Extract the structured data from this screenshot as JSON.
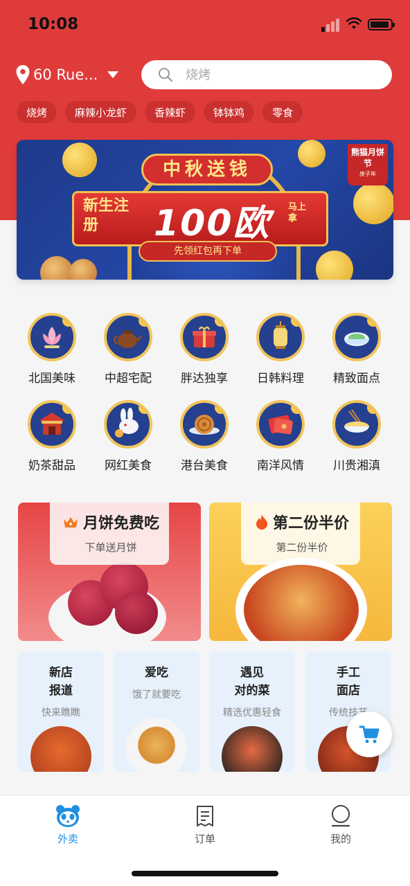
{
  "status_bar": {
    "time": "10:08"
  },
  "header": {
    "location": "60 Rue...",
    "search_placeholder": "烧烤"
  },
  "quick_tags": [
    "烧烤",
    "麻辣小龙虾",
    "香辣虾",
    "钵钵鸡",
    "零食"
  ],
  "banner": {
    "headline": "中秋送钱",
    "left_text": "新生注册",
    "big_text": "100欧",
    "side_text": "马上拿",
    "sub_text": "先领红包再下单",
    "badge_title": "熊猫月饼节",
    "badge_sub": "庚子年"
  },
  "categories": [
    {
      "label": "北国美味",
      "icon": "lotus-icon"
    },
    {
      "label": "中超宅配",
      "icon": "teapot-icon"
    },
    {
      "label": "胖达独享",
      "icon": "gift-box-icon"
    },
    {
      "label": "日韩料理",
      "icon": "lantern-icon"
    },
    {
      "label": "精致面点",
      "icon": "dumpling-bowl-icon"
    },
    {
      "label": "奶茶甜品",
      "icon": "pavilion-icon"
    },
    {
      "label": "网红美食",
      "icon": "rabbit-icon"
    },
    {
      "label": "港台美食",
      "icon": "mooncake-icon"
    },
    {
      "label": "南洋风情",
      "icon": "red-envelope-icon"
    },
    {
      "label": "川贵湘滇",
      "icon": "noodle-bowl-icon"
    }
  ],
  "promos": [
    {
      "title": "月饼免费吃",
      "subtitle": "下单送月饼",
      "icon": "crown-icon"
    },
    {
      "title": "第二份半价",
      "subtitle": "第二份半价",
      "icon": "flame-icon"
    }
  ],
  "tiles": [
    {
      "title": "新店\n报道",
      "subtitle": "快来瞧瞧"
    },
    {
      "title": "爱吃",
      "subtitle": "饿了就要吃"
    },
    {
      "title": "遇见\n对的菜",
      "subtitle": "精选优惠轻食"
    },
    {
      "title": "手工\n面店",
      "subtitle": "传统技艺"
    }
  ],
  "tabbar": [
    {
      "label": "外卖",
      "icon": "panda-icon",
      "active": true
    },
    {
      "label": "订单",
      "icon": "receipt-icon",
      "active": false
    },
    {
      "label": "我的",
      "icon": "profile-icon",
      "active": false
    }
  ],
  "colors": {
    "brand_red": "#e03b3b",
    "accent_blue": "#1f8fe0"
  }
}
